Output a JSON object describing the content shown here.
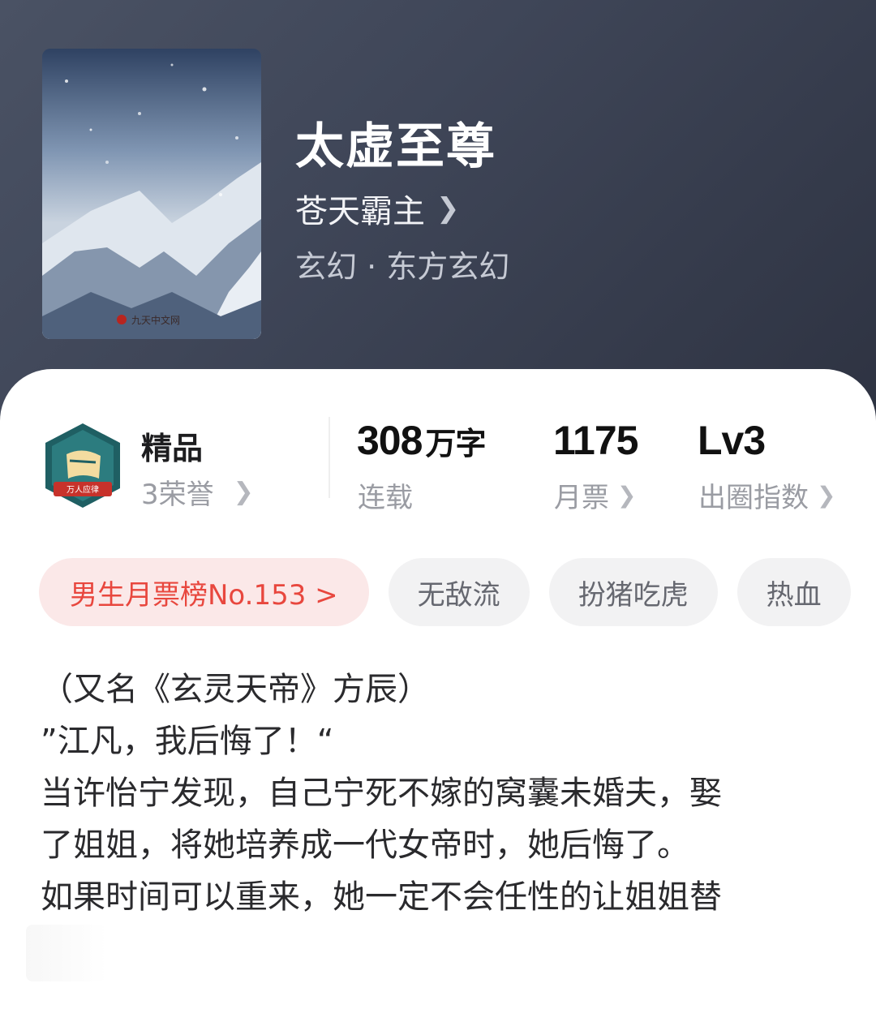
{
  "book": {
    "title": "太虚至尊",
    "author": "苍天霸主",
    "genre": "玄幻 · 东方玄幻",
    "cover_publisher": "九天中文网"
  },
  "honor": {
    "level": "精品",
    "count": "3荣誉",
    "badge_text": "万人应律"
  },
  "stats": {
    "words_value": "308",
    "words_unit": "万字",
    "status": "连载",
    "monthly_votes": "1175",
    "monthly_votes_label": "月票",
    "influence": "Lv3",
    "influence_label": "出圈指数"
  },
  "tags": {
    "rank": "男生月票榜No.153 >",
    "items": [
      "无敌流",
      "扮猪吃虎",
      "热血"
    ]
  },
  "description": {
    "lines": [
      "（又名《玄灵天帝》方辰）",
      "”江凡，我后悔了！“",
      "当许怡宁发现，自己宁死不嫁的窝囊未婚夫，娶",
      "了姐姐，将她培养成一代女帝时，她后悔了。",
      "如果时间可以重来，她一定不会任性的让姐姐替"
    ]
  },
  "colors": {
    "hero_bg": "#3f4658",
    "accent_red": "#e8473e",
    "tag_bg": "#f2f2f3"
  }
}
